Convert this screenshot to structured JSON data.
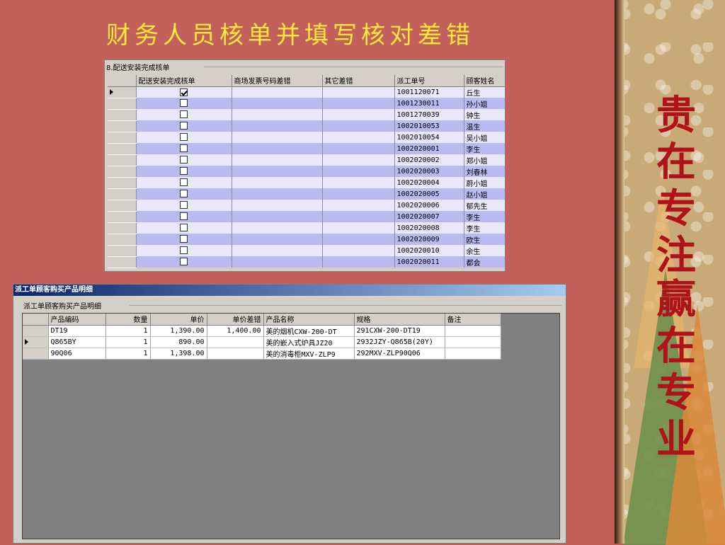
{
  "slide": {
    "title": "财务人员核单并填写核对差错",
    "slogan_top": "贵\n在\n专\n注",
    "slogan_bottom": "赢\n在\n专\n业"
  },
  "upper": {
    "group_label": "8.配送安装完成核单",
    "columns": [
      "配送安装完成核单",
      "商场发票号码差错",
      "其它差错",
      "派工单号",
      "顾客姓名"
    ],
    "rows": [
      {
        "checked": true,
        "order_no": "1001120071",
        "customer": "丘生"
      },
      {
        "checked": false,
        "order_no": "1001230011",
        "customer": "孙小姐"
      },
      {
        "checked": false,
        "order_no": "1001270039",
        "customer": "钟生"
      },
      {
        "checked": false,
        "order_no": "1002010053",
        "customer": "温生"
      },
      {
        "checked": false,
        "order_no": "1002010054",
        "customer": "吴小姐"
      },
      {
        "checked": false,
        "order_no": "1002020001",
        "customer": "李生"
      },
      {
        "checked": false,
        "order_no": "1002020002",
        "customer": "郑小姐"
      },
      {
        "checked": false,
        "order_no": "1002020003",
        "customer": "刘春林"
      },
      {
        "checked": false,
        "order_no": "1002020004",
        "customer": "蔚小姐"
      },
      {
        "checked": false,
        "order_no": "1002020005",
        "customer": "赵小姐"
      },
      {
        "checked": false,
        "order_no": "1002020006",
        "customer": "郁先生"
      },
      {
        "checked": false,
        "order_no": "1002020007",
        "customer": "李生"
      },
      {
        "checked": false,
        "order_no": "1002020008",
        "customer": "李生"
      },
      {
        "checked": false,
        "order_no": "1002020009",
        "customer": "欧生"
      },
      {
        "checked": false,
        "order_no": "1002020010",
        "customer": "余生"
      },
      {
        "checked": false,
        "order_no": "1002020011",
        "customer": "都会"
      }
    ]
  },
  "lower": {
    "window_title": "派工单顾客购买产品明细",
    "group_label": "派工单顾客购买产品明细",
    "columns": [
      "产品编码",
      "数量",
      "单价",
      "单价差错",
      "产品名称",
      "规格",
      "备注"
    ],
    "rows": [
      {
        "code": "DT19",
        "qty": "1",
        "price": "1,390.00",
        "price_diff": "1,400.00",
        "name": "美的烟机CXW-200-DT",
        "spec": "291CXW-200-DT19",
        "note": ""
      },
      {
        "code": "Q865BY",
        "qty": "1",
        "price": "890.00",
        "price_diff": "",
        "name": "美的嵌入式炉具JZ20",
        "spec": "2932JZY-Q865B(20Y)",
        "note": ""
      },
      {
        "code": "90Q06",
        "qty": "1",
        "price": "1,398.00",
        "price_diff": "",
        "name": "美的消毒柜MXV-ZLP9",
        "spec": "292MXV-ZLP90Q06",
        "note": ""
      }
    ]
  }
}
